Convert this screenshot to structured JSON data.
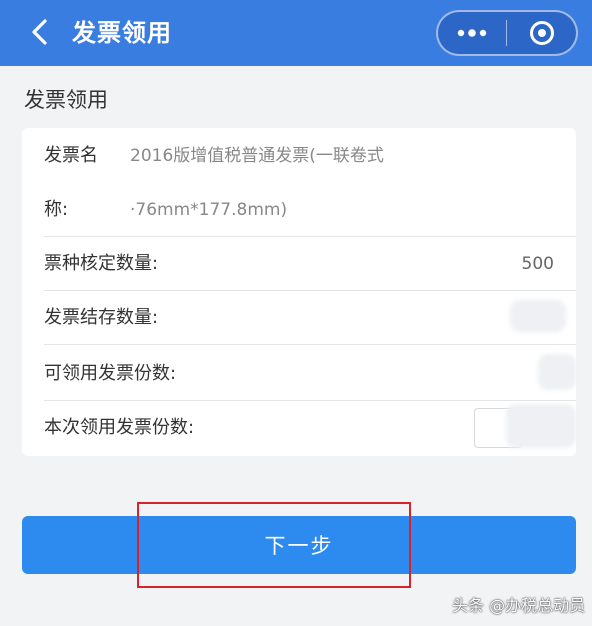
{
  "nav": {
    "title": "发票领用",
    "back_icon": "chevron-left-icon",
    "more_icon": "more-dots-icon",
    "close_icon": "target-close-icon",
    "bar_color": "#3a7de0"
  },
  "section_title": "发票领用",
  "fields": {
    "invoice_name_label_1": "发票名",
    "invoice_name_label_2": "称:",
    "invoice_name_value_1": "2016版增值税普通发票(一联卷式",
    "invoice_name_value_2": "·76mm*177.8mm)",
    "approved_qty_label": "票种核定数量:",
    "approved_qty_value": "500",
    "stock_qty_label": "发票结存数量:",
    "available_label": "可领用发票份数:",
    "current_label": "本次领用发票份数:"
  },
  "next_button": {
    "label": "下一步",
    "color": "#2d8bf0"
  },
  "watermark": "头条 @办税总动员"
}
